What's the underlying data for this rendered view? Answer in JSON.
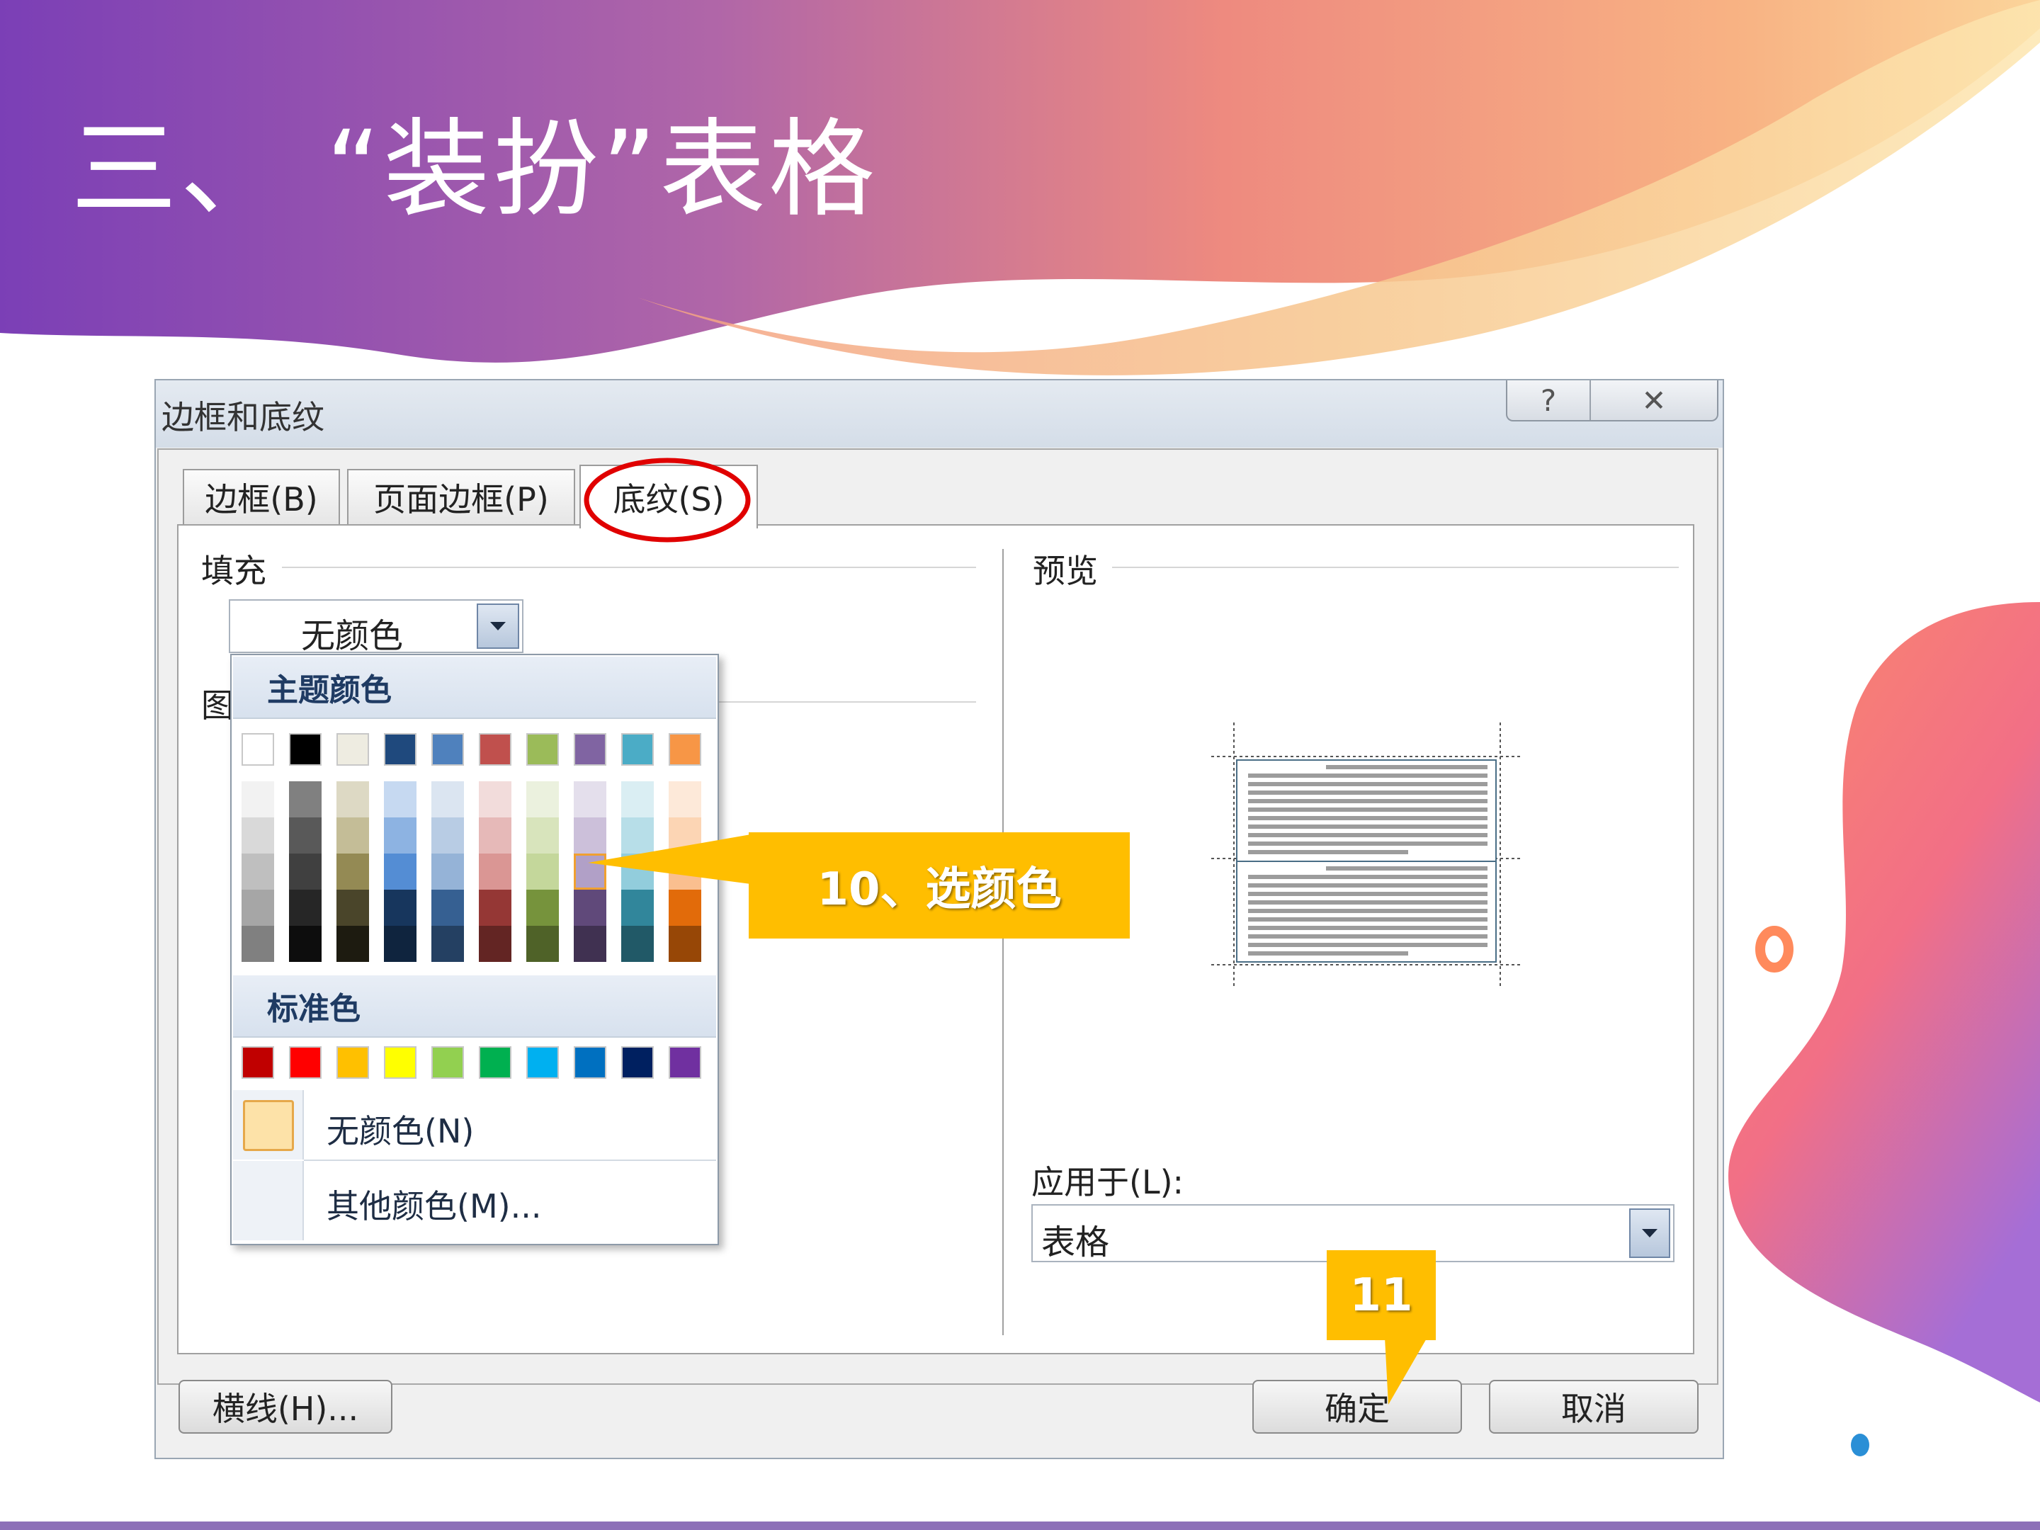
{
  "slide": {
    "title": "三、 “装扮”表格"
  },
  "dialog": {
    "title": "边框和底纹",
    "controls": {
      "help": "?",
      "close": "✕"
    },
    "tabs": [
      {
        "label": "边框(B)"
      },
      {
        "label": "页面边框(P)"
      },
      {
        "label": "底纹(S)",
        "active": true
      }
    ],
    "fill": {
      "label": "填充",
      "value": "无颜色"
    },
    "pattern_label": "图",
    "color_popup": {
      "theme_header": "主题颜色",
      "standard_header": "标准色",
      "no_color": "无颜色(N)",
      "more_colors": "其他颜色(M)...",
      "theme_top_row": [
        "#ffffff",
        "#000000",
        "#eeece1",
        "#1f497d",
        "#4f81bd",
        "#c0504d",
        "#9bbb59",
        "#8064a2",
        "#4bacc6",
        "#f79646"
      ],
      "theme_columns": [
        [
          "#f2f2f2",
          "#d9d9d9",
          "#bfbfbf",
          "#a6a6a6",
          "#808080"
        ],
        [
          "#808080",
          "#595959",
          "#404040",
          "#262626",
          "#0d0d0d"
        ],
        [
          "#ddd9c4",
          "#c4bd97",
          "#948a54",
          "#4a452a",
          "#1d1b10"
        ],
        [
          "#c6d9f1",
          "#8db3e2",
          "#548dd4",
          "#17365d",
          "#0f243e"
        ],
        [
          "#dbe5f1",
          "#b8cce4",
          "#95b3d7",
          "#366092",
          "#244062"
        ],
        [
          "#f2dcdb",
          "#e6b9b8",
          "#da9694",
          "#953735",
          "#632523"
        ],
        [
          "#ebf1de",
          "#d8e4bc",
          "#c4d79b",
          "#76933c",
          "#4f6228"
        ],
        [
          "#e4dfec",
          "#ccc0da",
          "#b1a0c7",
          "#60497a",
          "#403151"
        ],
        [
          "#daeef3",
          "#b7dee8",
          "#92cddc",
          "#31869b",
          "#215967"
        ],
        [
          "#fde9d9",
          "#fcd5b4",
          "#fabf8f",
          "#e26b0a",
          "#974706"
        ]
      ],
      "standard_colors": [
        "#c00000",
        "#ff0000",
        "#ffc000",
        "#ffff00",
        "#92d050",
        "#00b050",
        "#00b0f0",
        "#0070c0",
        "#002060",
        "#7030a0"
      ]
    },
    "preview": {
      "label": "预览"
    },
    "apply_to": {
      "label": "应用于(L):",
      "value": "表格"
    },
    "buttons": {
      "horizontal_line": "横线(H)...",
      "ok": "确定",
      "cancel": "取消"
    }
  },
  "annotations": {
    "step10": "10、选颜色",
    "step11": "11"
  },
  "colors": {
    "callout": "#ffbe00",
    "highlight_circle": "#e00000"
  }
}
